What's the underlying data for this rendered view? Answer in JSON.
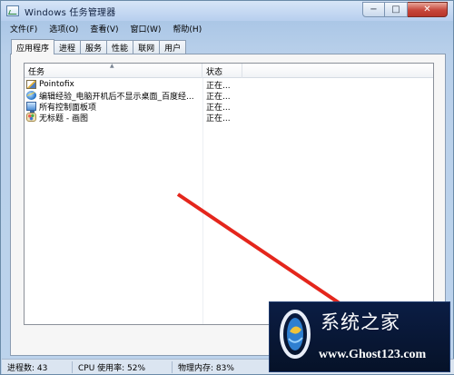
{
  "window": {
    "title": "Windows 任务管理器",
    "controls": {
      "minimize": "−",
      "maximize": "□",
      "close": "✕"
    }
  },
  "menu": [
    {
      "label": "文件(F)"
    },
    {
      "label": "选项(O)"
    },
    {
      "label": "查看(V)"
    },
    {
      "label": "窗口(W)"
    },
    {
      "label": "帮助(H)"
    }
  ],
  "tabs": [
    {
      "label": "应用程序",
      "active": true
    },
    {
      "label": "进程",
      "active": false
    },
    {
      "label": "服务",
      "active": false
    },
    {
      "label": "性能",
      "active": false
    },
    {
      "label": "联网",
      "active": false
    },
    {
      "label": "用户",
      "active": false
    }
  ],
  "list": {
    "columns": {
      "task": "任务",
      "status": "状态"
    },
    "rows": [
      {
        "icon": "pointofix-icon",
        "task": "Pointofix",
        "status": "正在..."
      },
      {
        "icon": "ie-browser-icon",
        "task": "编辑经验_电脑开机后不显示桌面_百度经...",
        "status": "正在..."
      },
      {
        "icon": "control-panel-icon",
        "task": "所有控制面板项",
        "status": "正在..."
      },
      {
        "icon": "paint-icon",
        "task": "无标题 - 画图",
        "status": "正在..."
      }
    ]
  },
  "statusbar": {
    "processes": "进程数: 43",
    "cpu": "CPU 使用率: 52%",
    "memory": "物理内存: 83%"
  },
  "watermark": {
    "title": "系统之家",
    "url": "www.Ghost123.com"
  },
  "colors": {
    "annotation_arrow": "#e4261c",
    "watermark_bg": "#0b1d44"
  }
}
